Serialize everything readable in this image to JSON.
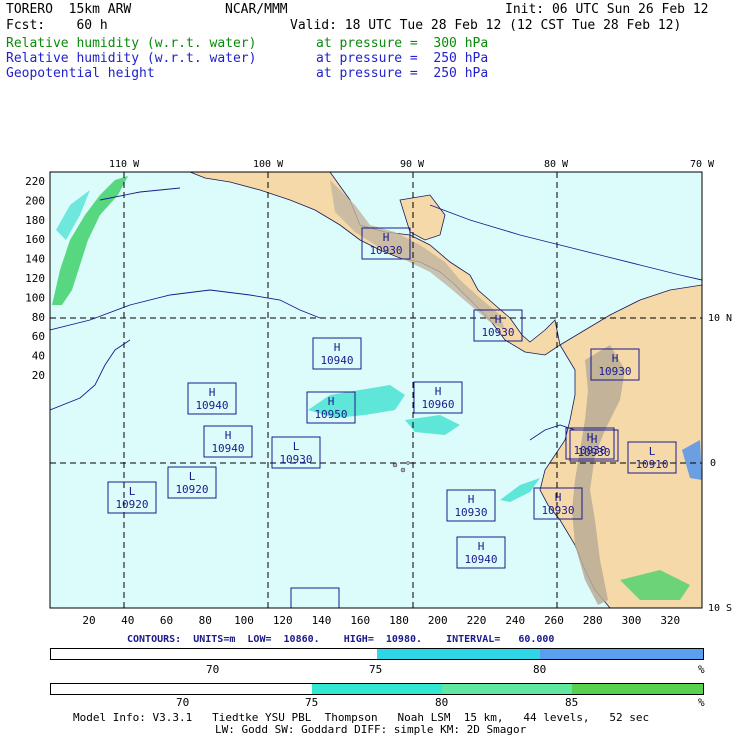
{
  "header": {
    "model": "TORERO  15km ARW",
    "org": "NCAR/MMM",
    "init": "Init: 06 UTC Sun 26 Feb 12",
    "fcst": "Fcst:    60 h",
    "valid": "Valid: 18 UTC Tue 28 Feb 12 (12 CST Tue 28 Feb 12)",
    "fields": [
      {
        "name": "Relative humidity (w.r.t. water)",
        "level": "at pressure =  300 hPa",
        "color": "#0a8a0a"
      },
      {
        "name": "Relative humidity (w.r.t. water)",
        "level": "at pressure =  250 hPa",
        "color": "#2222cc"
      },
      {
        "name": "Geopotential height",
        "level": "at pressure =  250 hPa",
        "color": "#2222cc"
      }
    ]
  },
  "map": {
    "lon_labels": [
      "110 W",
      "100 W",
      "90 W",
      "80 W",
      "70 W"
    ],
    "lat_labels": [
      "10 N",
      "0",
      "10 S"
    ],
    "y_ticks": [
      "220",
      "200",
      "180",
      "160",
      "140",
      "120",
      "100",
      "80",
      "60",
      "40",
      "20"
    ],
    "x_ticks": [
      "20",
      "40",
      "60",
      "80",
      "100",
      "120",
      "140",
      "160",
      "180",
      "200",
      "220",
      "240",
      "260",
      "280",
      "300",
      "320"
    ],
    "highs_lows": [
      {
        "type": "H",
        "value": "10930"
      },
      {
        "type": "H",
        "value": "10930"
      },
      {
        "type": "H",
        "value": "10940"
      },
      {
        "type": "H",
        "value": "10930"
      },
      {
        "type": "H",
        "value": "10940"
      },
      {
        "type": "H",
        "value": "10950"
      },
      {
        "type": "H",
        "value": "10960"
      },
      {
        "type": "H",
        "value": "10940"
      },
      {
        "type": "L",
        "value": "10930"
      },
      {
        "type": "H",
        "value": "10930"
      },
      {
        "type": "L",
        "value": "10910"
      },
      {
        "type": "L",
        "value": "10920"
      },
      {
        "type": "L",
        "value": "10920"
      },
      {
        "type": "H",
        "value": "10930"
      },
      {
        "type": "H",
        "value": "10930"
      },
      {
        "type": "H",
        "value": "10940"
      },
      {
        "type": "H",
        "value": "10930"
      },
      {
        "type": "",
        "value": ""
      }
    ],
    "colors": {
      "ocean": "#dcfcfc",
      "land": "#f5d9a8",
      "terrain": "#c8b8a0",
      "rh_green": "#3fd06a",
      "rh_cyan": "#3fe0d0",
      "rh_blue": "#4a8ef0",
      "contour": "#1a1a8c"
    }
  },
  "contours": {
    "text": "CONTOURS:  UNITS=m  LOW=  10860.    HIGH=  10980.    INTERVAL=   60.000"
  },
  "colorbar1": {
    "ticks": [
      "70",
      "75",
      "80",
      "%"
    ],
    "colors": [
      "#ffffff",
      "#2ed6e6",
      "#5aa0ef"
    ]
  },
  "colorbar2": {
    "ticks": [
      "70",
      "75",
      "80",
      "85",
      "%"
    ],
    "colors": [
      "#ffffff",
      "#32e8d2",
      "#5ee8a0",
      "#58d050"
    ]
  },
  "footer": {
    "line1": "Model Info: V3.3.1   Tiedtke YSU PBL  Thompson   Noah LSM  15 km,   44 levels,   52 sec",
    "line2": "LW: Godd SW: Goddard DIFF: simple KM: 2D Smagor"
  }
}
